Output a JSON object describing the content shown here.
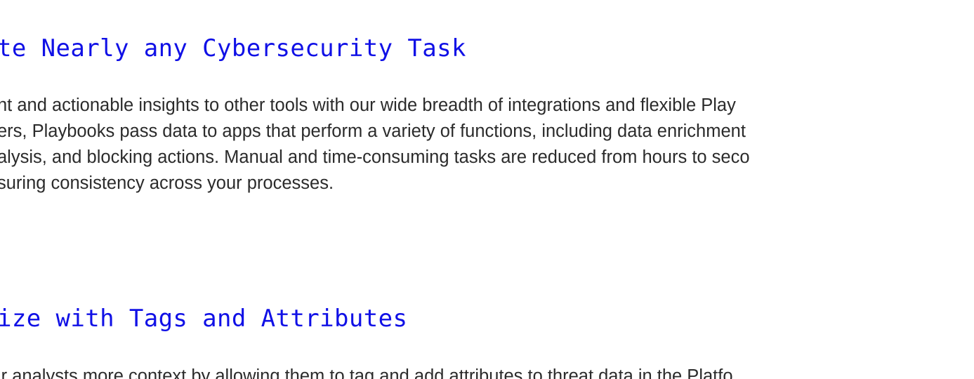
{
  "sections": [
    {
      "heading": "te Nearly any Cybersecurity Task",
      "lines": [
        "nt and actionable insights to other tools with our wide breadth of integrations and flexible Play",
        "ers, Playbooks pass data to apps that perform a variety of functions, including data enrichment",
        "alysis, and blocking actions. Manual and time-consuming tasks are reduced from hours to seco",
        "suring consistency across your processes."
      ]
    },
    {
      "heading": "ize with Tags and Attributes",
      "lines": [
        "ir analysts more context by allowing them to tag and add attributes to threat data in the Platfo"
      ]
    }
  ]
}
